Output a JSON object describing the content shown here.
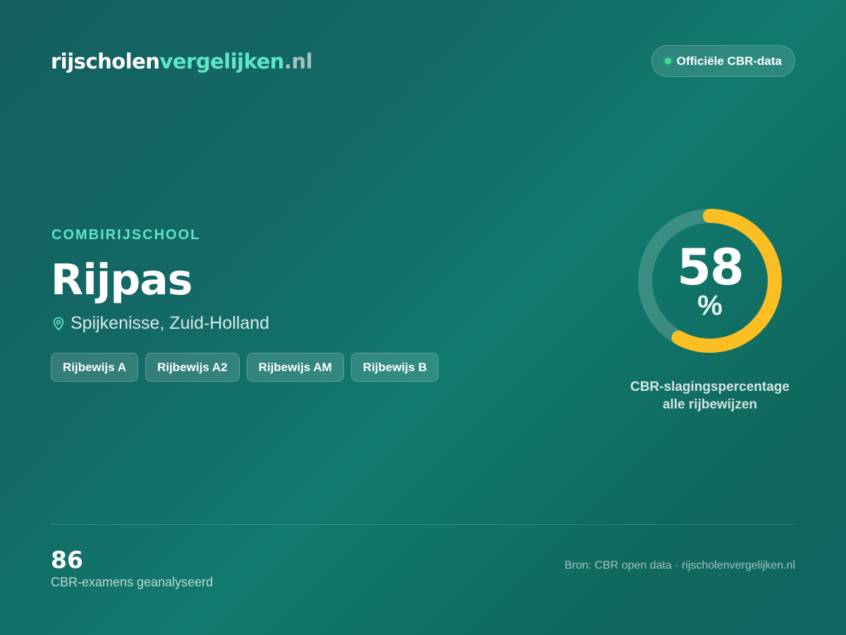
{
  "header": {
    "logo": {
      "part1": "rijscholen",
      "part2": "vergelijken",
      "part3": ".nl"
    },
    "badge_label": "Officiële CBR-data"
  },
  "school": {
    "category": "COMBIRIJSCHOOL",
    "name": "Rijpas",
    "location": "Spijkenisse, Zuid-Holland",
    "licenses": [
      {
        "label": "Rijbewijs A"
      },
      {
        "label": "Rijbewijs A2"
      },
      {
        "label": "Rijbewijs AM"
      },
      {
        "label": "Rijbewijs B"
      }
    ]
  },
  "pass_rate": {
    "value": 58,
    "unit": "%",
    "caption_line1": "CBR-slagingspercentage",
    "caption_line2": "alle rijbewijzen"
  },
  "footer": {
    "exams_count": "86",
    "exams_label": "CBR-examens geanalyseerd",
    "source": "Bron: CBR open data · rijscholenvergelijken.nl"
  },
  "colors": {
    "accent": "#5ee6c6",
    "gauge_fill": "#fbbf24",
    "status_dot": "#3ee08a"
  },
  "icons": {
    "location": "map-pin-icon",
    "status": "status-dot-icon"
  }
}
